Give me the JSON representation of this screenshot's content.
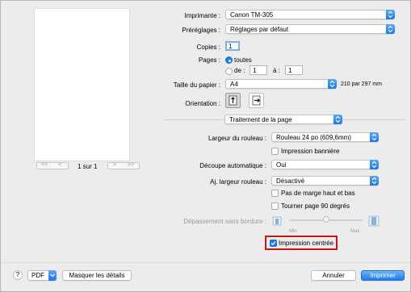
{
  "colors": {
    "accent": "#1a7ef0",
    "highlight_border": "#d0121b",
    "window_bg": "#ececec"
  },
  "preview": {
    "page_count": "1 sur 1",
    "first_label": "<<",
    "prev_label": "<",
    "next_label": ">",
    "last_label": ">>"
  },
  "printer": {
    "label": "Imprimante :",
    "value": "Canon TM-305"
  },
  "presets": {
    "label": "Préréglages :",
    "value": "Réglages par défaut"
  },
  "copies": {
    "label": "Copies :",
    "value": "1"
  },
  "pages": {
    "label": "Pages :",
    "all_label": "toutes",
    "from_label": "de :",
    "from_value": "1",
    "to_label": "à :",
    "to_value": "1",
    "selected": "toutes"
  },
  "paper_size": {
    "label": "Taille du papier :",
    "value": "A4",
    "dimensions": "210 par 297 mm"
  },
  "orientation": {
    "label": "Orientation :",
    "selected": "portrait"
  },
  "section": {
    "value": "Traitement de la page"
  },
  "roll_width": {
    "label": "Largeur du rouleau :",
    "value": "Rouleau 24 po (609,6mm)"
  },
  "banner_print": {
    "label": "Impression bannière",
    "checked": false
  },
  "auto_cut": {
    "label": "Découpe automatique :",
    "value": "Oui"
  },
  "fit_roll_width": {
    "label": "Aj. largeur rouleau :",
    "value": "Désactivé"
  },
  "no_top_bottom_margin": {
    "label": "Pas de marge haut et bas",
    "checked": false
  },
  "rotate_90": {
    "label": "Tourner page 90 degrés",
    "checked": false
  },
  "borderless_overflow": {
    "label": "Dépassement sans bordure :",
    "min_label": "Min",
    "max_label": "Max",
    "level": 0.5
  },
  "center_print": {
    "label": "Impression centrée",
    "checked": true
  },
  "footer": {
    "help_label": "?",
    "pdf_label": "PDF",
    "hide_details_label": "Masquer les détails",
    "cancel_label": "Annuler",
    "print_label": "Imprimer"
  }
}
